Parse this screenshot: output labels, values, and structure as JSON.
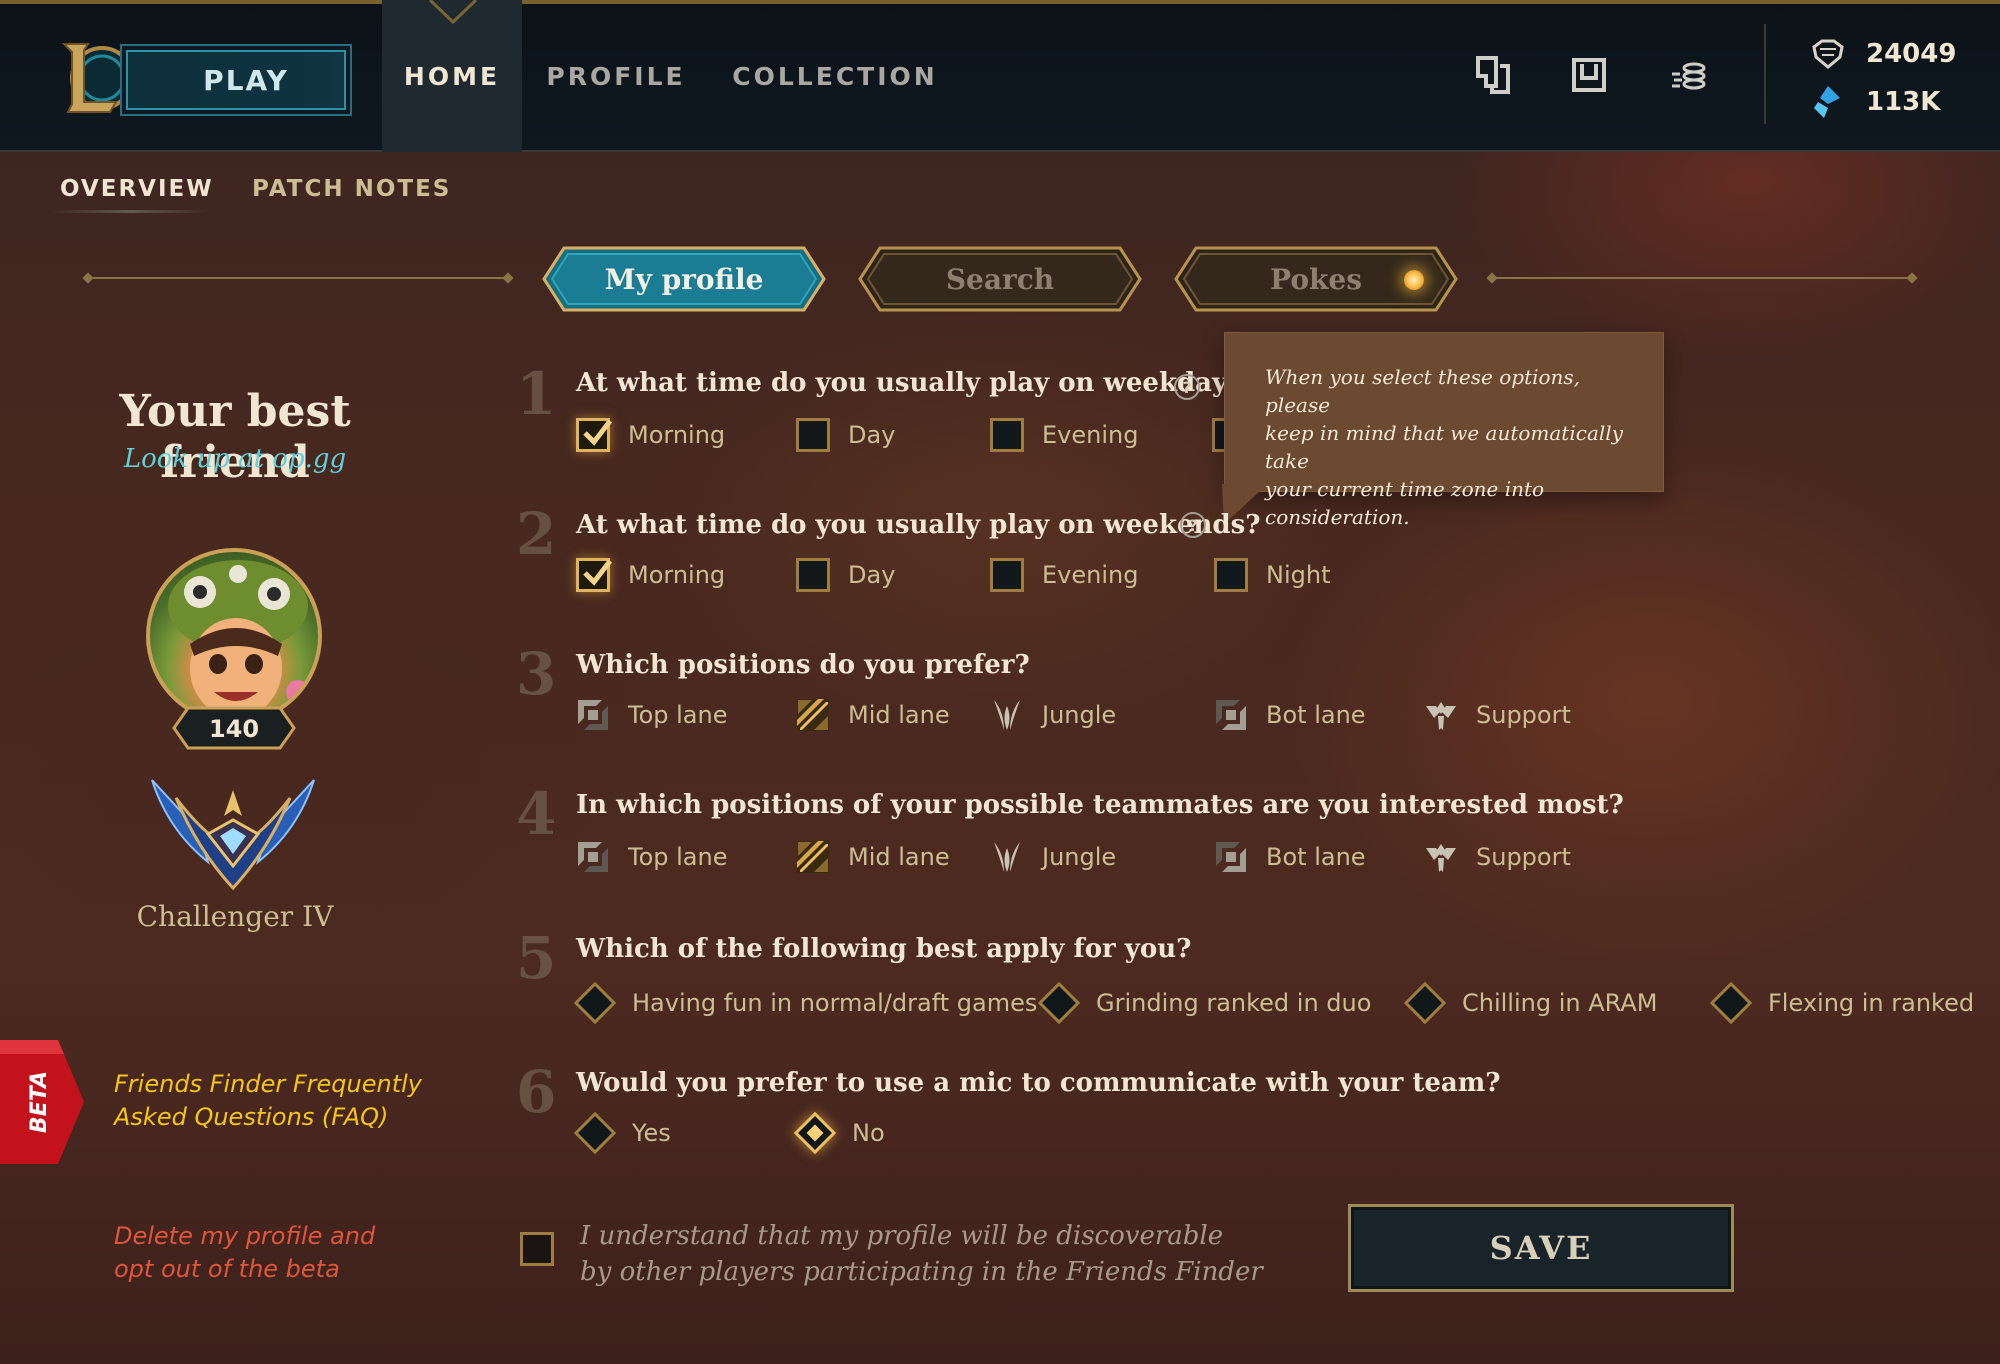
{
  "colors": {
    "accent_gold": "#c8aa6e",
    "accent_teal": "#0ac8b9",
    "link_teal": "#5fd0d8",
    "faq_yellow": "#f5c518",
    "danger": "#e0563c",
    "beta_red": "#c4121c"
  },
  "header": {
    "play_label": "PLAY",
    "nav": [
      {
        "label": "HOME",
        "active": true
      },
      {
        "label": "PROFILE",
        "active": false
      },
      {
        "label": "COLLECTION",
        "active": false
      }
    ],
    "icons": [
      "clash-icon",
      "store-icon",
      "loot-icon"
    ],
    "currency": {
      "blue_essence": "24049",
      "riot_points": "113K"
    }
  },
  "subnav": {
    "items": [
      {
        "label": "OVERVIEW",
        "active": true
      },
      {
        "label": "PATCH NOTES",
        "active": false
      }
    ]
  },
  "tabs": [
    {
      "label": "My profile",
      "active": true
    },
    {
      "label": "Search",
      "active": false
    },
    {
      "label": "Pokes",
      "active": false,
      "notification": true
    }
  ],
  "sidebar": {
    "title": "Your best friend",
    "subtitle": "Look up at op.gg",
    "level": "140",
    "rank": "Challenger IV",
    "beta_label": "BETA",
    "faq_link": [
      "Friends Finder Frequently",
      "Asked Questions (FAQ)"
    ],
    "delete_link": [
      "Delete my profile and",
      "opt out of the beta"
    ]
  },
  "tooltip": {
    "lines": [
      "When you select these options, please",
      "keep in mind that we automatically take",
      "your current time zone into consideration."
    ]
  },
  "questions": [
    {
      "num": "1",
      "text": "At what time do you usually play on weekdays?",
      "options": [
        {
          "label": "Morning",
          "checked": true
        },
        {
          "label": "Day",
          "checked": false
        },
        {
          "label": "Evening",
          "checked": false
        }
      ]
    },
    {
      "num": "2",
      "text": "At what time do you  usually play on weekends?",
      "options": [
        {
          "label": "Morning",
          "checked": true
        },
        {
          "label": "Day",
          "checked": false
        },
        {
          "label": "Evening",
          "checked": false
        },
        {
          "label": "Night",
          "checked": false
        }
      ]
    },
    {
      "num": "3",
      "text": "Which positions do you prefer?",
      "options": [
        {
          "label": "Top lane",
          "selected": false
        },
        {
          "label": "Mid lane",
          "selected": true
        },
        {
          "label": "Jungle",
          "selected": false
        },
        {
          "label": "Bot lane",
          "selected": false
        },
        {
          "label": "Support",
          "selected": false
        }
      ]
    },
    {
      "num": "4",
      "text": "In which positions of your possible teammates are you interested most?",
      "options": [
        {
          "label": "Top lane",
          "selected": false
        },
        {
          "label": "Mid lane",
          "selected": true
        },
        {
          "label": "Jungle",
          "selected": false
        },
        {
          "label": "Bot lane",
          "selected": false
        },
        {
          "label": "Support",
          "selected": false
        }
      ]
    },
    {
      "num": "5",
      "text": "Which of the following best apply for you?",
      "options": [
        {
          "label": "Having fun in normal/draft games",
          "selected": false
        },
        {
          "label": "Grinding ranked in duo",
          "selected": false
        },
        {
          "label": "Chilling in ARAM",
          "selected": false
        },
        {
          "label": "Flexing in ranked",
          "selected": false
        }
      ]
    },
    {
      "num": "6",
      "text": "Would you prefer to use a mic to communicate with your team?",
      "options": [
        {
          "label": "Yes",
          "selected": false
        },
        {
          "label": "No",
          "selected": true
        }
      ]
    }
  ],
  "consent": {
    "lines": [
      "I understand that my profile will be discoverable",
      "by other players participating in the Friends Finder"
    ],
    "checked": false
  },
  "save_label": "SAVE"
}
